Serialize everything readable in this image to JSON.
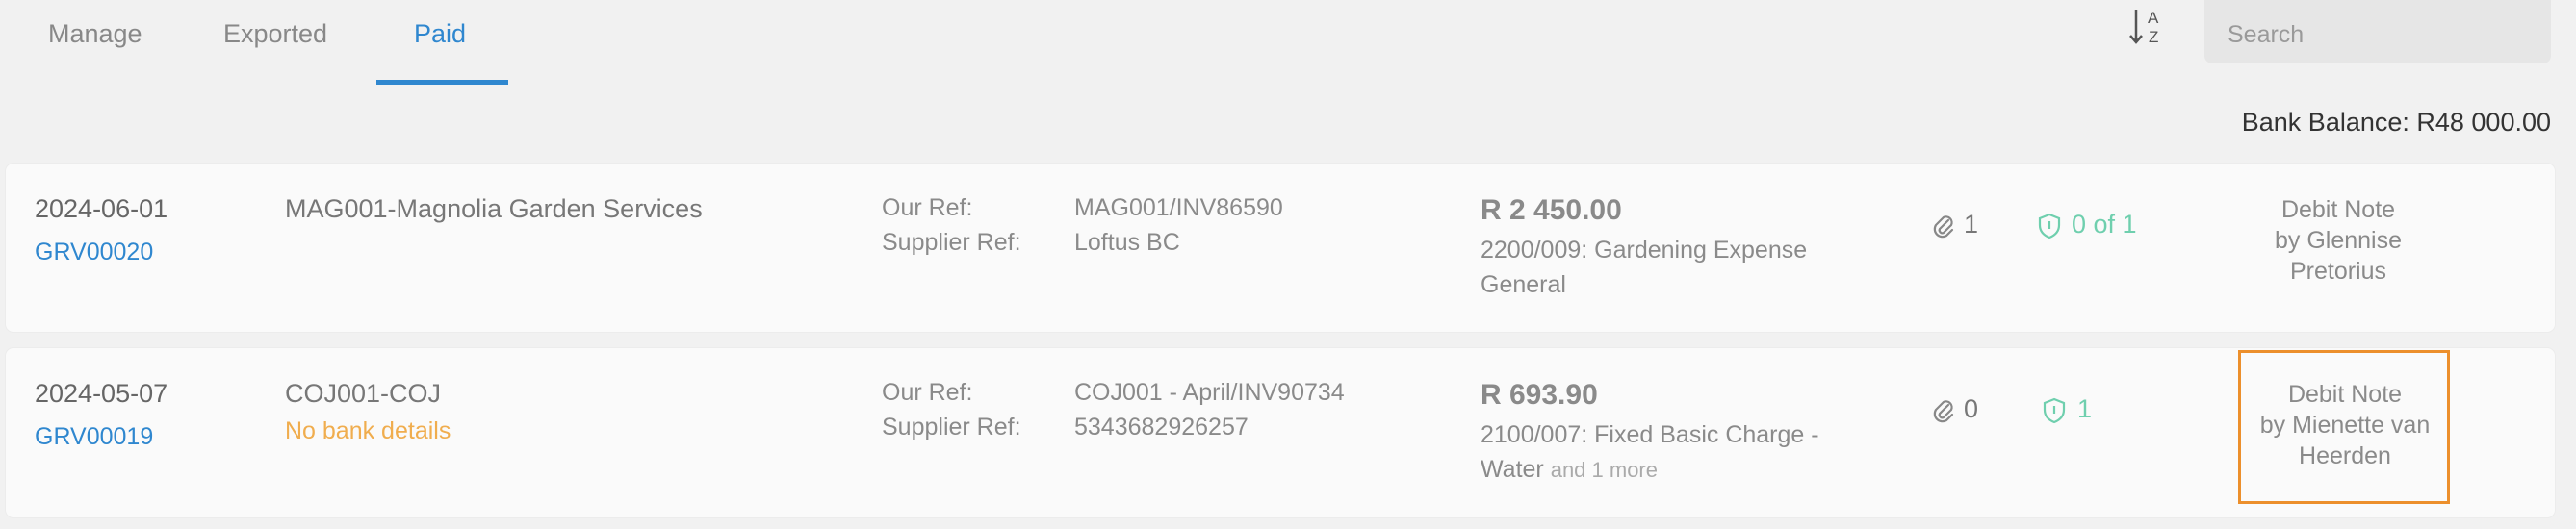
{
  "tabs": [
    {
      "label": "Manage",
      "active": false
    },
    {
      "label": "Exported",
      "active": false
    },
    {
      "label": "Paid",
      "active": true
    }
  ],
  "search": {
    "placeholder": "Search",
    "value": ""
  },
  "sort_icon": "sort-a-z-icon",
  "bank_balance": "Bank Balance: R48 000.00",
  "labels": {
    "our_ref": "Our Ref:",
    "supplier_ref": "Supplier Ref:"
  },
  "rows": [
    {
      "date": "2024-06-01",
      "grv": "GRV00020",
      "supplier": "MAG001-Magnolia Garden Services",
      "warning": "",
      "our_ref": "MAG001/INV86590",
      "supplier_ref": "Loftus BC",
      "amount": "R 2 450.00",
      "account": "2200/009: Gardening Expense General",
      "more": "",
      "attachments": "1",
      "approvals": "0 of 1",
      "note_type": "Debit Note",
      "note_by": "by Glennise Pretorius"
    },
    {
      "date": "2024-05-07",
      "grv": "GRV00019",
      "supplier": "COJ001-COJ",
      "warning": "No bank details",
      "our_ref": "COJ001 - April/INV90734",
      "supplier_ref": "5343682926257",
      "amount": "R 693.90",
      "account": "2100/007: Fixed Basic Charge - Water",
      "more": "and 1 more",
      "attachments": "0",
      "approvals": "1",
      "note_type": "Debit Note",
      "note_by": "by Mienette van Heerden"
    }
  ],
  "colors": {
    "accent": "#2f87cf",
    "warning": "#f0ad4e",
    "approval": "#6fcfae",
    "highlight": "#ec8f2c"
  }
}
